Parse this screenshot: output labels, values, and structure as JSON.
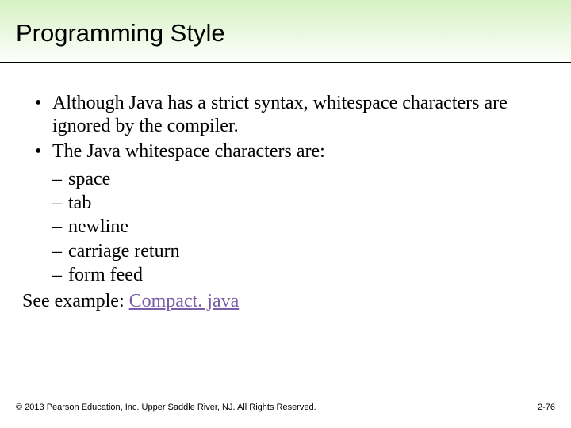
{
  "title": "Programming Style",
  "bullets": [
    "Although Java has a strict syntax, whitespace characters are ignored by the compiler.",
    "The Java whitespace characters are:"
  ],
  "sub_items": [
    "space",
    "tab",
    "newline",
    "carriage return",
    "form feed"
  ],
  "see_example_prefix": "See example: ",
  "see_example_link": "Compact. java",
  "footer": {
    "copyright": "© 2013 Pearson Education, Inc. Upper Saddle River, NJ. All Rights Reserved.",
    "page": "2-76"
  },
  "colors": {
    "link": "#7b5ea7",
    "gradient_top": "#d6f2c4"
  }
}
